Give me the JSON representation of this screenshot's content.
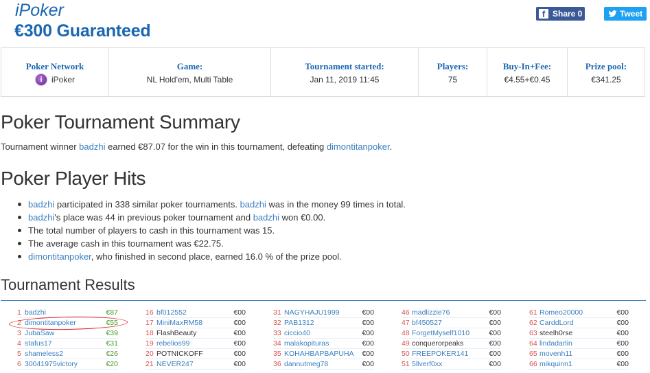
{
  "header": {
    "brand": "iPoker",
    "title": "€300 Guaranteed",
    "share_label": "Share 0",
    "tweet_label": "Tweet"
  },
  "info": [
    {
      "label": "Poker Network",
      "value": "iPoker",
      "icon": "ipoker-logo-icon"
    },
    {
      "label": "Game:",
      "value": "NL Hold'em, Multi Table"
    },
    {
      "label": "Tournament started:",
      "value": "Jan 11, 2019 11:45"
    },
    {
      "label": "Players:",
      "value": "75"
    },
    {
      "label": "Buy-In+Fee:",
      "value": "€4.55+€0.45"
    },
    {
      "label": "Prize pool:",
      "value": "€341.25"
    }
  ],
  "summary": {
    "heading": "Poker Tournament Summary",
    "t1": "Tournament winner ",
    "winner": "badzhi",
    "t2": " earned €87.07 for the win in this tournament, defeating ",
    "runner_up": "dimontitanpoker",
    "t3": "."
  },
  "hits": {
    "heading": "Poker Player Hits",
    "items": [
      {
        "a": "badzhi",
        "b": " participated in 338 similar poker tournaments. ",
        "c": "badzhi",
        "d": " was in the money 99 times in total."
      },
      {
        "a": "badzhi",
        "b": "'s place was 44 in previous poker tournament and ",
        "c": "badzhi",
        "d": " won €0.00."
      },
      {
        "text": "The total number of players to cash in this tournament was 15."
      },
      {
        "text": "The average cash in this tournament was €22.75."
      },
      {
        "a": "dimontitanpoker",
        "b": ", who finished in second place, earned 16.0 % of the prize pool."
      }
    ]
  },
  "results": {
    "heading": "Tournament Results",
    "columns": [
      [
        {
          "pos": "1",
          "name": "badzhi",
          "prize": "€87",
          "win": true
        },
        {
          "pos": "2",
          "name": "dimontitanpoker",
          "prize": "€55",
          "win": true
        },
        {
          "pos": "3",
          "name": "JubaSaw",
          "prize": "€39",
          "win": true
        },
        {
          "pos": "4",
          "name": "stafus17",
          "prize": "€31",
          "win": true
        },
        {
          "pos": "5",
          "name": "shameless2",
          "prize": "€26",
          "win": true
        },
        {
          "pos": "6",
          "name": "30041975victory",
          "prize": "€20",
          "win": true
        }
      ],
      [
        {
          "pos": "16",
          "name": "bf012552",
          "prize": "€00"
        },
        {
          "pos": "17",
          "name": "MiniMaxRM58",
          "prize": "€00"
        },
        {
          "pos": "18",
          "name": "FlashBeauty",
          "prize": "€00",
          "plain": true
        },
        {
          "pos": "19",
          "name": "rebelios99",
          "prize": "€00"
        },
        {
          "pos": "20",
          "name": "POTNICKOFF",
          "prize": "€00",
          "plain": true
        },
        {
          "pos": "21",
          "name": "NEVER247",
          "prize": "€00"
        }
      ],
      [
        {
          "pos": "31",
          "name": "NAGYHAJU1999",
          "prize": "€00"
        },
        {
          "pos": "32",
          "name": "PAB1312",
          "prize": "€00"
        },
        {
          "pos": "33",
          "name": "ciccio40",
          "prize": "€00"
        },
        {
          "pos": "34",
          "name": "malakopituras",
          "prize": "€00"
        },
        {
          "pos": "35",
          "name": "KOHAHBAPBAPUHA",
          "prize": "€00"
        },
        {
          "pos": "36",
          "name": "dannutmeg78",
          "prize": "€00"
        }
      ],
      [
        {
          "pos": "46",
          "name": "madlizzie76",
          "prize": "€00"
        },
        {
          "pos": "47",
          "name": "bf450527",
          "prize": "€00"
        },
        {
          "pos": "48",
          "name": "ForgetMyself1010",
          "prize": "€00"
        },
        {
          "pos": "49",
          "name": "conquerorpeaks",
          "prize": "€00",
          "plain": true
        },
        {
          "pos": "50",
          "name": "FREEPOKER141",
          "prize": "€00"
        },
        {
          "pos": "51",
          "name": "5llverf0xx",
          "prize": "€00"
        }
      ],
      [
        {
          "pos": "61",
          "name": "Romeo20000",
          "prize": "€00"
        },
        {
          "pos": "62",
          "name": "CarddLord",
          "prize": "€00"
        },
        {
          "pos": "63",
          "name": "steelh0rse",
          "prize": "€00",
          "plain": true
        },
        {
          "pos": "64",
          "name": "lindadarlin",
          "prize": "€00"
        },
        {
          "pos": "65",
          "name": "movenh11",
          "prize": "€00"
        },
        {
          "pos": "66",
          "name": "mikquinn1",
          "prize": "€00"
        }
      ]
    ]
  }
}
